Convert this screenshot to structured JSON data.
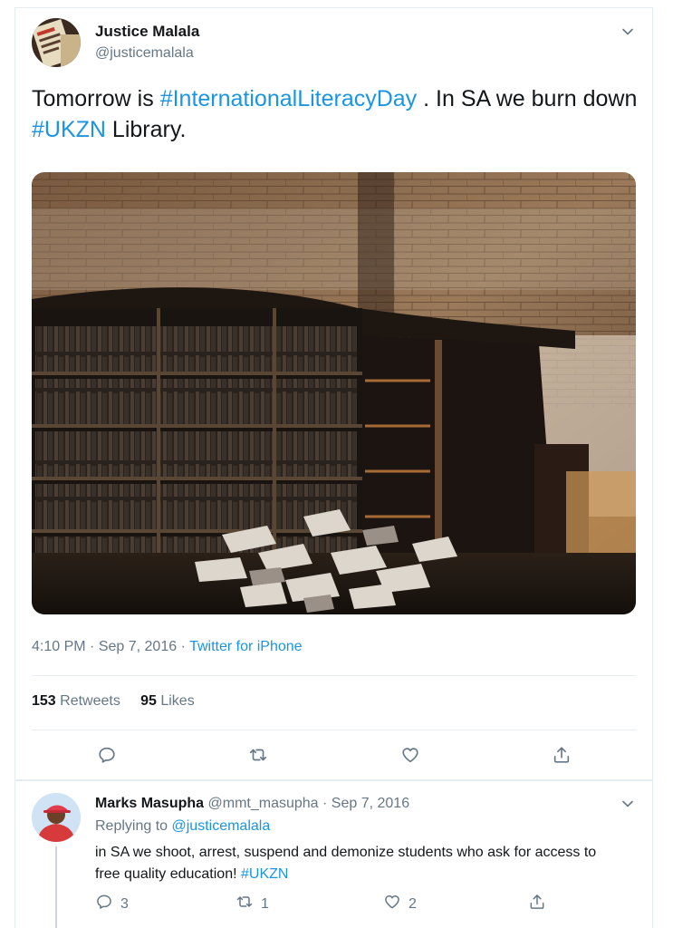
{
  "tweet": {
    "author_name": "Justice Malala",
    "author_handle": "@justicemalala",
    "text_parts": [
      {
        "t": "Tomorrow is ",
        "tag": false
      },
      {
        "t": "#InternationalLiteracyDay",
        "tag": true
      },
      {
        "t": " . In SA we burn down ",
        "tag": false
      },
      {
        "t": "#UKZN",
        "tag": true
      },
      {
        "t": " Library.",
        "tag": false
      }
    ],
    "time": "4:10 PM",
    "date": "Sep 7, 2016",
    "source": "Twitter for iPhone",
    "retweets_count": "153",
    "retweets_label": "Retweets",
    "likes_count": "95",
    "likes_label": "Likes"
  },
  "reply": {
    "author_name": "Marks Masupha",
    "author_handle": "@mmt_masupha",
    "date": "Sep 7, 2016",
    "replying_label": "Replying to",
    "replying_to": "@justicemalala",
    "text": "in SA we shoot, arrest, suspend and demonize students who ask for access to free quality education!",
    "hashtag": "#UKZN",
    "reply_count": "3",
    "retweet_count": "1",
    "like_count": "2"
  },
  "icons": [
    "chevron-down-icon",
    "reply-icon",
    "retweet-icon",
    "like-icon",
    "share-icon"
  ],
  "colors": {
    "link": "#1b95e0",
    "muted": "#657786",
    "text": "#14171a",
    "border": "#e6ecf0"
  }
}
